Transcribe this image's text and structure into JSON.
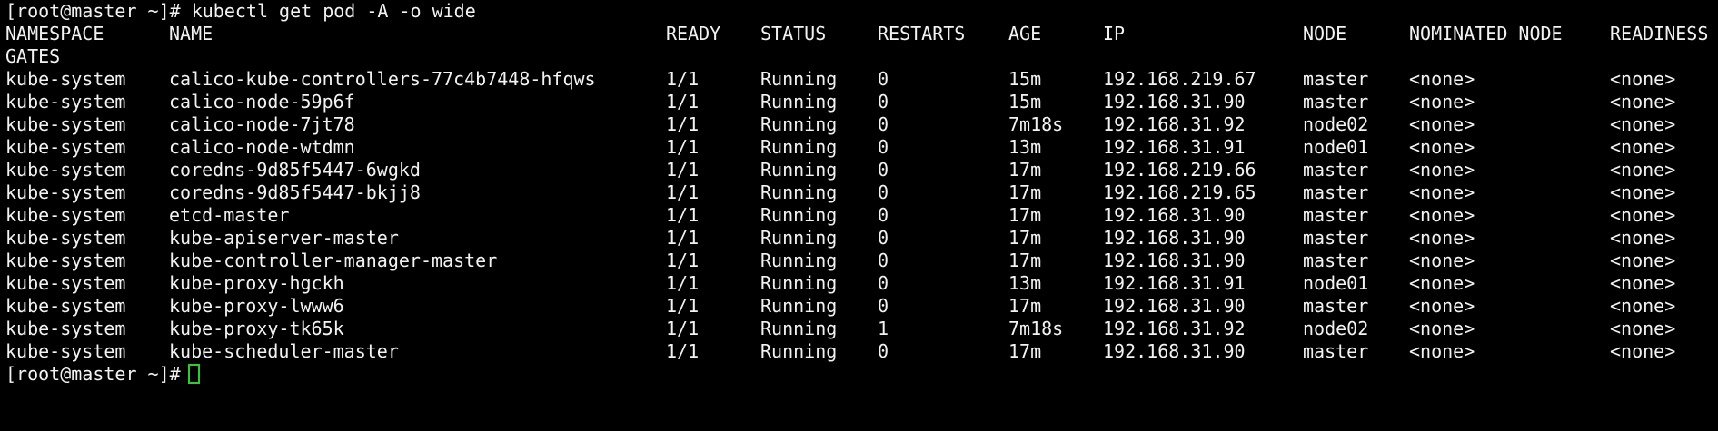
{
  "terminal": {
    "command_line": "[root@master ~]# kubectl get pod -A -o wide",
    "headers": {
      "namespace": "NAMESPACE",
      "name": "NAME",
      "ready": "READY",
      "status": "STATUS",
      "restarts": "RESTARTS",
      "age": "AGE",
      "ip": "IP",
      "node": "NODE",
      "nominated_node": "NOMINATED NODE",
      "readiness": "READINESS",
      "gates": "GATES"
    },
    "rows": [
      {
        "namespace": "kube-system",
        "name": "calico-kube-controllers-77c4b7448-hfqws",
        "ready": "1/1",
        "status": "Running",
        "restarts": "0",
        "age": "15m",
        "ip": "192.168.219.67",
        "node": "master",
        "nominated_node": "<none>",
        "readiness_gates": "<none>"
      },
      {
        "namespace": "kube-system",
        "name": "calico-node-59p6f",
        "ready": "1/1",
        "status": "Running",
        "restarts": "0",
        "age": "15m",
        "ip": "192.168.31.90",
        "node": "master",
        "nominated_node": "<none>",
        "readiness_gates": "<none>"
      },
      {
        "namespace": "kube-system",
        "name": "calico-node-7jt78",
        "ready": "1/1",
        "status": "Running",
        "restarts": "0",
        "age": "7m18s",
        "ip": "192.168.31.92",
        "node": "node02",
        "nominated_node": "<none>",
        "readiness_gates": "<none>"
      },
      {
        "namespace": "kube-system",
        "name": "calico-node-wtdmn",
        "ready": "1/1",
        "status": "Running",
        "restarts": "0",
        "age": "13m",
        "ip": "192.168.31.91",
        "node": "node01",
        "nominated_node": "<none>",
        "readiness_gates": "<none>"
      },
      {
        "namespace": "kube-system",
        "name": "coredns-9d85f5447-6wgkd",
        "ready": "1/1",
        "status": "Running",
        "restarts": "0",
        "age": "17m",
        "ip": "192.168.219.66",
        "node": "master",
        "nominated_node": "<none>",
        "readiness_gates": "<none>"
      },
      {
        "namespace": "kube-system",
        "name": "coredns-9d85f5447-bkjj8",
        "ready": "1/1",
        "status": "Running",
        "restarts": "0",
        "age": "17m",
        "ip": "192.168.219.65",
        "node": "master",
        "nominated_node": "<none>",
        "readiness_gates": "<none>"
      },
      {
        "namespace": "kube-system",
        "name": "etcd-master",
        "ready": "1/1",
        "status": "Running",
        "restarts": "0",
        "age": "17m",
        "ip": "192.168.31.90",
        "node": "master",
        "nominated_node": "<none>",
        "readiness_gates": "<none>"
      },
      {
        "namespace": "kube-system",
        "name": "kube-apiserver-master",
        "ready": "1/1",
        "status": "Running",
        "restarts": "0",
        "age": "17m",
        "ip": "192.168.31.90",
        "node": "master",
        "nominated_node": "<none>",
        "readiness_gates": "<none>"
      },
      {
        "namespace": "kube-system",
        "name": "kube-controller-manager-master",
        "ready": "1/1",
        "status": "Running",
        "restarts": "0",
        "age": "17m",
        "ip": "192.168.31.90",
        "node": "master",
        "nominated_node": "<none>",
        "readiness_gates": "<none>"
      },
      {
        "namespace": "kube-system",
        "name": "kube-proxy-hgckh",
        "ready": "1/1",
        "status": "Running",
        "restarts": "0",
        "age": "13m",
        "ip": "192.168.31.91",
        "node": "node01",
        "nominated_node": "<none>",
        "readiness_gates": "<none>"
      },
      {
        "namespace": "kube-system",
        "name": "kube-proxy-lwww6",
        "ready": "1/1",
        "status": "Running",
        "restarts": "0",
        "age": "17m",
        "ip": "192.168.31.90",
        "node": "master",
        "nominated_node": "<none>",
        "readiness_gates": "<none>"
      },
      {
        "namespace": "kube-system",
        "name": "kube-proxy-tk65k",
        "ready": "1/1",
        "status": "Running",
        "restarts": "1",
        "age": "7m18s",
        "ip": "192.168.31.92",
        "node": "node02",
        "nominated_node": "<none>",
        "readiness_gates": "<none>"
      },
      {
        "namespace": "kube-system",
        "name": "kube-scheduler-master",
        "ready": "1/1",
        "status": "Running",
        "restarts": "0",
        "age": "17m",
        "ip": "192.168.31.90",
        "node": "master",
        "nominated_node": "<none>",
        "readiness_gates": "<none>"
      }
    ],
    "prompt": "[root@master ~]#",
    "colors": {
      "background": "#000000",
      "foreground": "#f2f2f2",
      "cursor": "#2ecc2e"
    }
  }
}
